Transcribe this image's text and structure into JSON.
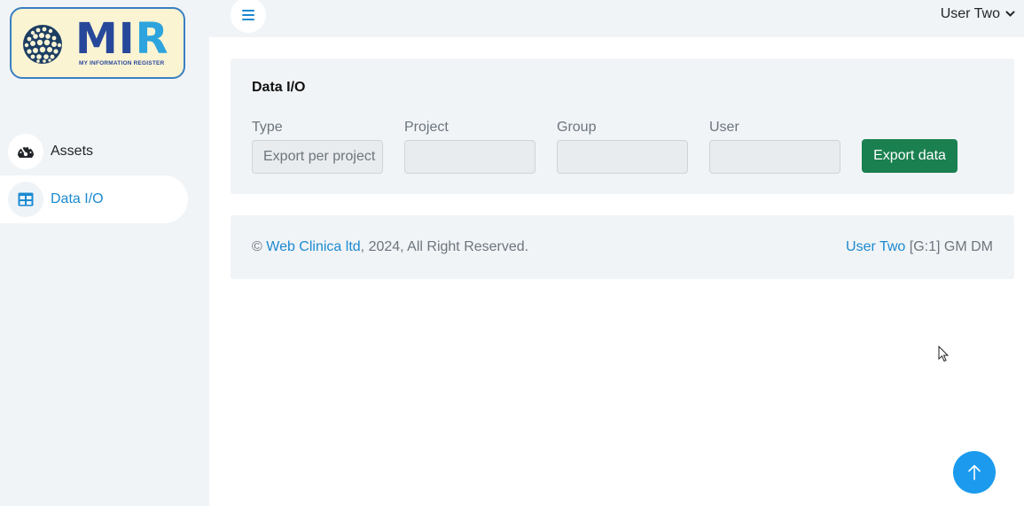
{
  "logo": {
    "title_main": "MI",
    "title_accent": "R",
    "tagline": "MY INFORMATION REGISTER"
  },
  "sidebar": {
    "items": [
      {
        "label": "Assets",
        "icon": "speedometer-icon",
        "active": false
      },
      {
        "label": "Data I/O",
        "icon": "table-icon",
        "active": true
      }
    ]
  },
  "header": {
    "menu_icon": "hamburger-icon",
    "user_name": "User Two"
  },
  "data_io": {
    "title": "Data I/O",
    "fields": {
      "type": {
        "label": "Type",
        "value": "Export per project"
      },
      "project": {
        "label": "Project",
        "value": ""
      },
      "group": {
        "label": "Group",
        "value": ""
      },
      "user": {
        "label": "User",
        "value": ""
      }
    },
    "export_button": "Export data"
  },
  "footer": {
    "copyright_symbol": "©",
    "company_link": "Web Clinica ltd",
    "rights_text": ", 2024, All Right Reserved.",
    "user_link": "User Two",
    "user_roles": "[G:1] GM DM"
  },
  "colors": {
    "accent": "#1b8ad0",
    "export_button": "#1a8050",
    "scroll_top": "#1b9aee",
    "panel_bg": "#f1f4f7"
  }
}
